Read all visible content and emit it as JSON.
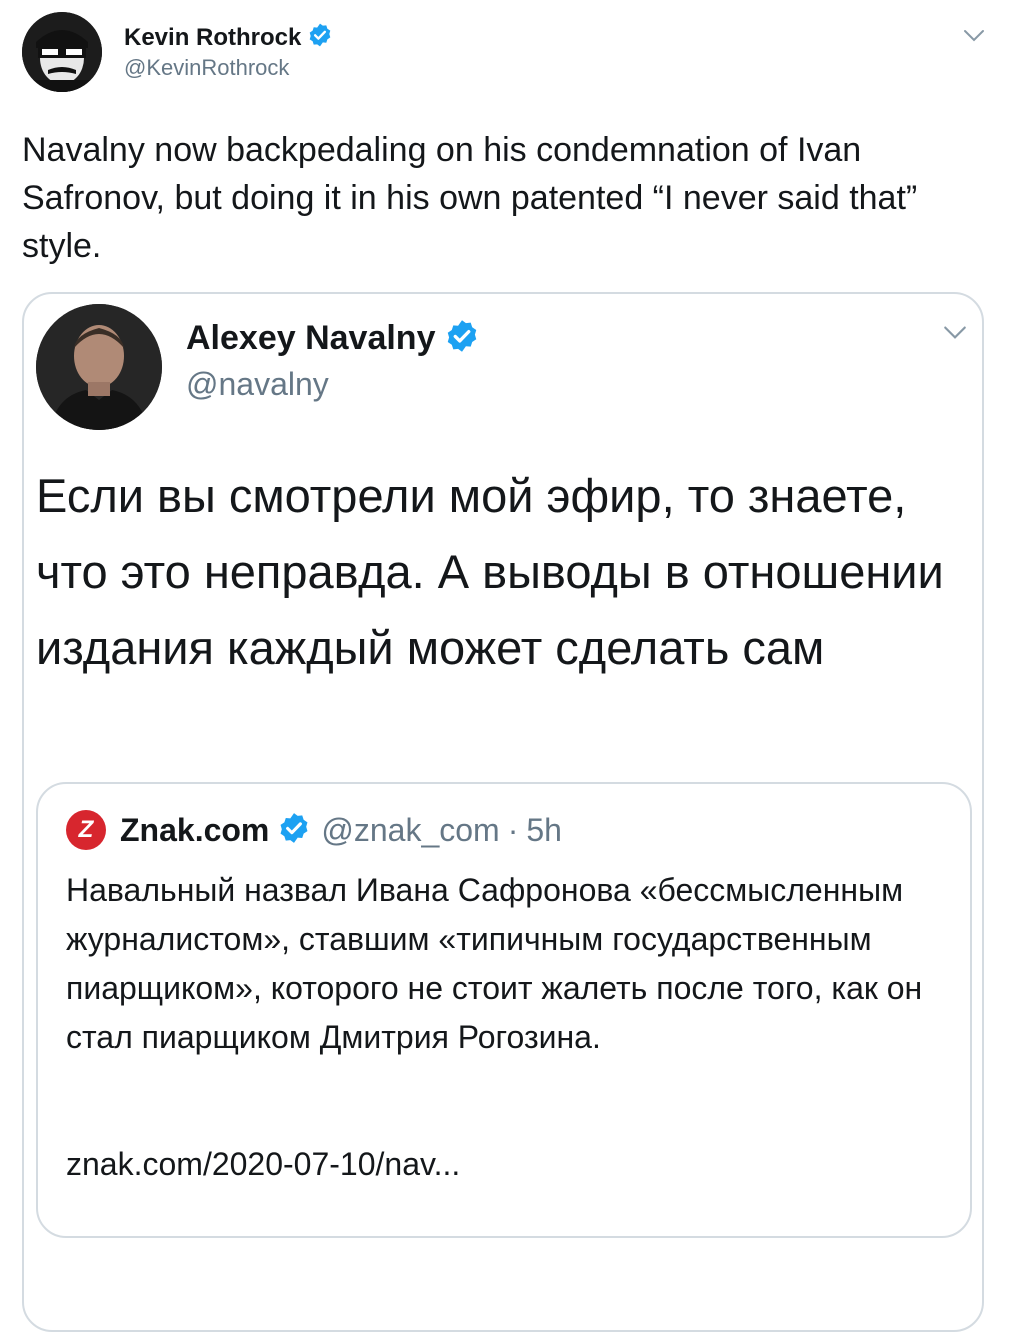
{
  "tweet": {
    "author": {
      "name": "Kevin Rothrock",
      "handle": "@KevinRothrock",
      "verified": true
    },
    "text": "Navalny now backpedaling on his condemnation of Ivan Safronov, but doing it in his own patented “I never said that” style.",
    "quoted": {
      "author": {
        "name": "Alexey Navalny",
        "handle": "@navalny",
        "verified": true
      },
      "text": "Если вы смотрели мой эфир, то знаете, что это неправда. А выводы в отношении издания каждый может сделать сам",
      "quoted": {
        "logo_letter": "Z",
        "author": {
          "name": "Znak.com",
          "handle": "@znak_com",
          "verified": true
        },
        "separator": "·",
        "time": "5h",
        "text": "Навальный назвал Ивана Сафронова «бессмысленным журналистом», ставшим «типичным государственным пиарщиком», которого не стоит жалеть после того, как он стал пиарщиком Дмитрия Рогозина.",
        "link": "znak.com/2020-07-10/nav..."
      }
    }
  },
  "colors": {
    "verified_blue": "#1da1f2",
    "znak_red": "#d7262e",
    "secondary_text": "#657786",
    "border": "#d4dbe1"
  }
}
